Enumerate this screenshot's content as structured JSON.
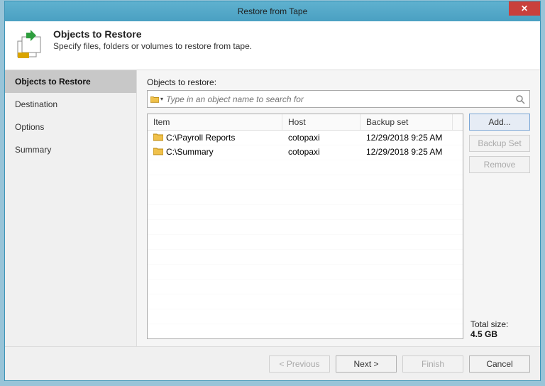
{
  "window": {
    "title": "Restore from Tape"
  },
  "header": {
    "title": "Objects to Restore",
    "subtitle": "Specify files, folders or volumes to restore from tape."
  },
  "sidebar": {
    "items": [
      {
        "label": "Objects to Restore",
        "active": true
      },
      {
        "label": "Destination",
        "active": false
      },
      {
        "label": "Options",
        "active": false
      },
      {
        "label": "Summary",
        "active": false
      }
    ]
  },
  "main": {
    "label": "Objects to restore:",
    "search": {
      "placeholder": "Type in an object name to search for"
    },
    "columns": {
      "item": "Item",
      "host": "Host",
      "set": "Backup set"
    },
    "rows": [
      {
        "item": "C:\\Payroll Reports",
        "host": "cotopaxi",
        "set": "12/29/2018 9:25 AM"
      },
      {
        "item": "C:\\Summary",
        "host": "cotopaxi",
        "set": "12/29/2018 9:25 AM"
      }
    ],
    "buttons": {
      "add": "Add...",
      "backupset": "Backup Set",
      "remove": "Remove"
    },
    "total": {
      "label": "Total size:",
      "value": "4.5 GB"
    }
  },
  "footer": {
    "previous": "< Previous",
    "next": "Next >",
    "finish": "Finish",
    "cancel": "Cancel"
  }
}
